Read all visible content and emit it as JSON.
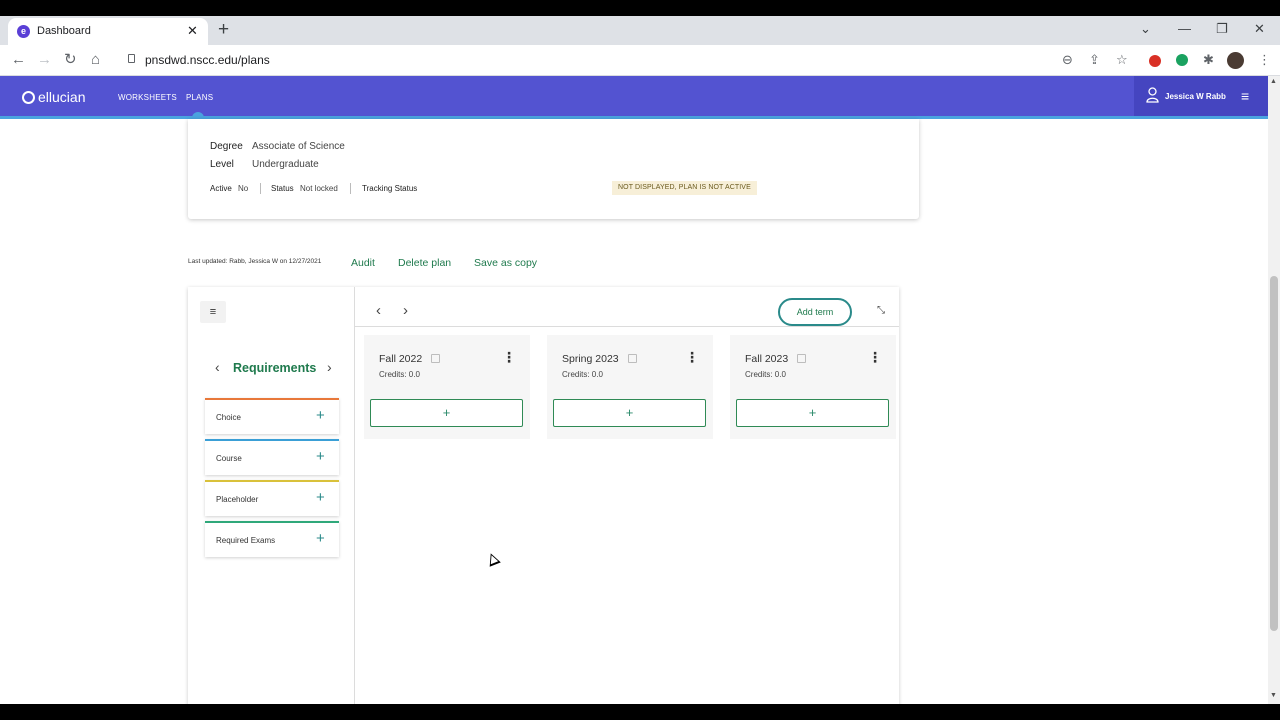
{
  "browser": {
    "tab_title": "Dashboard",
    "tab_close": "✕",
    "new_tab": "+",
    "url": "pnsdwd.nscc.edu/plans",
    "window_controls": {
      "dropdown": "⌄",
      "minimize": "—",
      "restore": "❐",
      "close": "✕"
    },
    "nav_icons": {
      "back": "←",
      "forward": "→",
      "reload": "↻",
      "home": "⌂"
    },
    "toolbar_icons": {
      "zoom": "⊖",
      "share": "⇪",
      "bookmark": "☆",
      "extensions": "✱",
      "menu": "⋮"
    }
  },
  "header": {
    "logo": "ellucian",
    "nav": [
      "WORKSHEETS",
      "PLANS"
    ],
    "user_name": "Jessica W Rabb",
    "menu_icon": "≡"
  },
  "plan_info": {
    "degree_label": "Degree",
    "degree_value": "Associate of Science",
    "level_label": "Level",
    "level_value": "Undergraduate",
    "active_label": "Active",
    "active_value": "No",
    "status_label": "Status",
    "status_value": "Not locked",
    "tracking_label": "Tracking Status",
    "tracking_value": "NOT DISPLAYED, PLAN IS NOT ACTIVE"
  },
  "actions": {
    "last_updated": "Last updated: Rabb, Jessica W on 12/27/2021",
    "audit": "Audit",
    "delete_plan": "Delete plan",
    "save_as_copy": "Save as copy"
  },
  "requirements": {
    "toggle_icon": "≡",
    "title": "Requirements",
    "prev": "‹",
    "next": "›",
    "items": [
      {
        "label": "Choice",
        "plus": "+",
        "color": "#e8783a"
      },
      {
        "label": "Course",
        "plus": "+",
        "color": "#3a9fd6"
      },
      {
        "label": "Placeholder",
        "plus": "+",
        "color": "#d9c13a"
      },
      {
        "label": "Required Exams",
        "plus": "+",
        "color": "#2fa87a"
      }
    ]
  },
  "board": {
    "prev": "‹",
    "next": "›",
    "add_term": "Add term",
    "expand_icon": "⤡",
    "terms": [
      {
        "name": "Fall 2022",
        "credits": "Credits:  0.0",
        "menu": "⋮",
        "add": "+"
      },
      {
        "name": "Spring 2023",
        "credits": "Credits:  0.0",
        "menu": "⋮",
        "add": "+"
      },
      {
        "name": "Fall 2023",
        "credits": "Credits:  0.0",
        "menu": "⋮",
        "add": "+"
      }
    ]
  },
  "scrollbar": {
    "up": "▲",
    "down": "▼"
  }
}
